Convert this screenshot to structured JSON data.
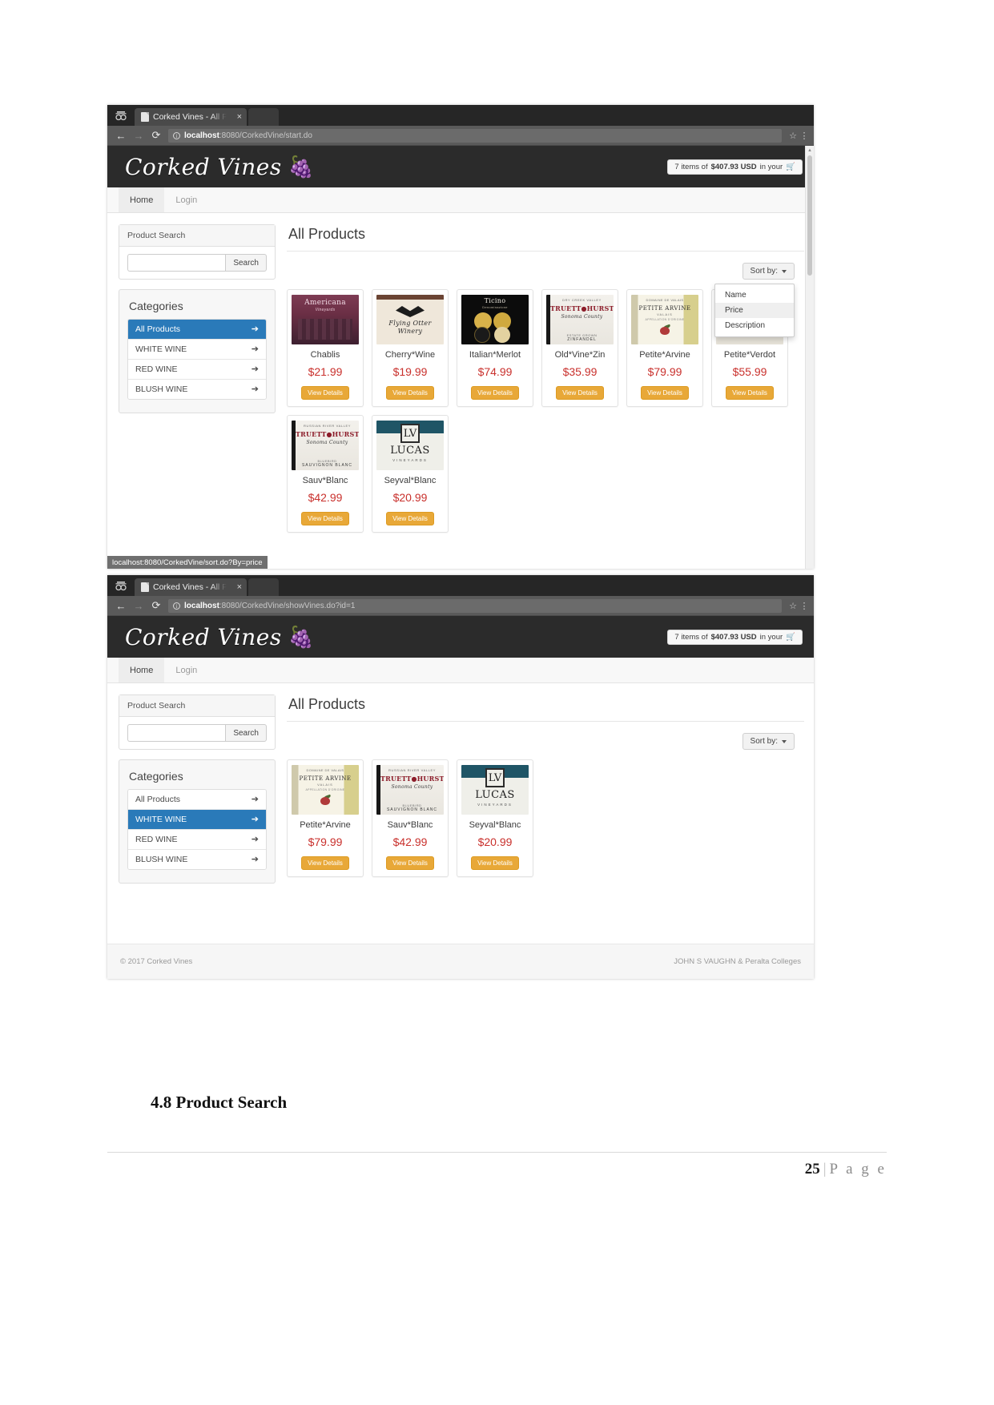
{
  "document": {
    "section_heading": "4.8 Product Search",
    "page_number": "25",
    "page_separator": "|",
    "page_word": "P a g e"
  },
  "window1": {
    "tab": {
      "title": "Corked Vines - All Pr",
      "close": "×"
    },
    "omnibox": {
      "back": "←",
      "forward": "→",
      "reload": "⟳",
      "info": "i",
      "url_host": "localhost",
      "url_rest": ":8080/CorkedVine/start.do",
      "star": "☆",
      "menu": "⋮"
    },
    "site": {
      "brand": "Corked Vines",
      "brand_glyph": "🍇",
      "cart": {
        "prefix": "7 items of ",
        "amount": "$407.93 USD",
        "suffix": " in your ",
        "icon": "🛒"
      },
      "nav": [
        {
          "label": "Home",
          "active": true
        },
        {
          "label": "Login",
          "active": false
        }
      ]
    },
    "sidebar": {
      "search_panel_title": "Product Search",
      "search_value": "",
      "search_placeholder": "",
      "search_button": "Search",
      "categories_title": "Categories",
      "categories": [
        {
          "label": "All Products",
          "active": true,
          "arrow": "➔"
        },
        {
          "label": "WHITE WINE",
          "active": false,
          "arrow": "➔"
        },
        {
          "label": "RED WINE",
          "active": false,
          "arrow": "➔"
        },
        {
          "label": "BLUSH WINE",
          "active": false,
          "arrow": "➔"
        }
      ]
    },
    "main": {
      "title": "All Products",
      "sort_label": "Sort by:",
      "sort_menu_open": true,
      "sort_options": [
        {
          "label": "Name",
          "hover": false
        },
        {
          "label": "Price",
          "hover": true
        },
        {
          "label": "Description",
          "hover": false
        }
      ],
      "details_button": "View Details",
      "products": [
        {
          "name": "Chablis",
          "price": "$21.99",
          "art": "lb-americana"
        },
        {
          "name": "Cherry*Wine",
          "price": "$19.99",
          "art": "lb-flying"
        },
        {
          "name": "Italian*Merlot",
          "price": "$74.99",
          "art": "lb-ticino"
        },
        {
          "name": "Old*Vine*Zin",
          "price": "$35.99",
          "art": "lb-truett"
        },
        {
          "name": "Petite*Arvine",
          "price": "$79.99",
          "art": "lb-petite"
        },
        {
          "name": "Petite*Verdot",
          "price": "$55.99",
          "art": "lb-verdot"
        }
      ],
      "products_row2": [
        {
          "name": "Sauv*Blanc",
          "price": "$42.99",
          "art": "lb-truett"
        },
        {
          "name": "Seyval*Blanc",
          "price": "$20.99",
          "art": "lb-lucas"
        }
      ]
    },
    "status_bar": "localhost:8080/CorkedVine/sort.do?By=price"
  },
  "window2": {
    "tab": {
      "title": "Corked Vines - All Pr",
      "close": "×"
    },
    "omnibox": {
      "back": "←",
      "forward": "→",
      "reload": "⟳",
      "info": "i",
      "url_host": "localhost",
      "url_rest": ":8080/CorkedVine/showVines.do?id=1",
      "star": "☆",
      "menu": "⋮"
    },
    "site": {
      "brand": "Corked Vines",
      "brand_glyph": "🍇",
      "cart": {
        "prefix": "7 items of ",
        "amount": "$407.93 USD",
        "suffix": " in your ",
        "icon": "🛒"
      },
      "nav": [
        {
          "label": "Home",
          "active": true
        },
        {
          "label": "Login",
          "active": false
        }
      ]
    },
    "sidebar": {
      "search_panel_title": "Product Search",
      "search_value": "",
      "search_placeholder": "",
      "search_button": "Search",
      "categories_title": "Categories",
      "categories": [
        {
          "label": "All Products",
          "active": false,
          "arrow": "➔"
        },
        {
          "label": "WHITE WINE",
          "active": true,
          "arrow": "➔"
        },
        {
          "label": "RED WINE",
          "active": false,
          "arrow": "➔"
        },
        {
          "label": "BLUSH WINE",
          "active": false,
          "arrow": "➔"
        }
      ]
    },
    "main": {
      "title": "All Products",
      "sort_label": "Sort by:",
      "sort_menu_open": false,
      "details_button": "View Details",
      "products": [
        {
          "name": "Petite*Arvine",
          "price": "$79.99",
          "art": "lb-petite"
        },
        {
          "name": "Sauv*Blanc",
          "price": "$42.99",
          "art": "lb-truett"
        },
        {
          "name": "Seyval*Blanc",
          "price": "$20.99",
          "art": "lb-lucas"
        }
      ]
    },
    "footer": {
      "copyright": "© 2017 Corked Vines",
      "credit": "JOHN S VAUGHN & Peralta Colleges"
    }
  },
  "colors": {
    "accent_blue": "#2a7ab9",
    "price_red": "#c9302c",
    "button_orange": "#e8a838",
    "header_dark": "#2b2b2b"
  }
}
